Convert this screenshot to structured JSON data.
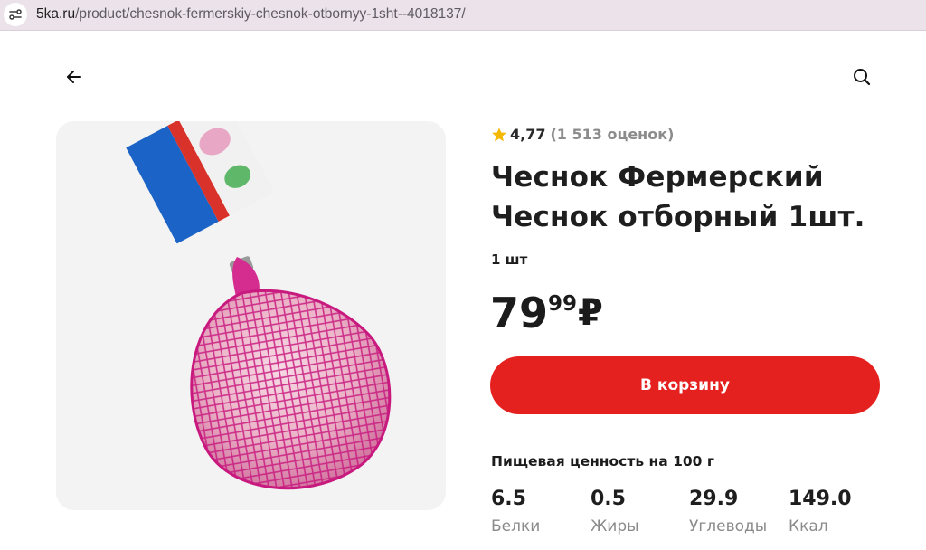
{
  "browser": {
    "url_host": "5ka.ru",
    "url_path": "/product/chesnok-fermerskiy-chesnok-otbornyy-1sht--4018137/"
  },
  "header": {
    "back_icon": "arrow-left-icon",
    "search_icon": "search-icon"
  },
  "product": {
    "image_alt_icon": "garlic-in-net-bag",
    "rating": {
      "score": "4,77",
      "count": "(1 513 оценок)",
      "star_color": "#f5b800"
    },
    "title_line1": "Чеснок Фермерский",
    "title_line2": "Чеснок отборный 1шт.",
    "weight": "1 шт",
    "price": {
      "rubles": "79",
      "kopecks": "99",
      "currency": "₽"
    },
    "cart_button": "В корзину",
    "accent_color": "#e5211f"
  },
  "nutrition": {
    "title": "Пищевая ценность на 100 г",
    "items": [
      {
        "value": "6.5",
        "label": "Белки"
      },
      {
        "value": "0.5",
        "label": "Жиры"
      },
      {
        "value": "29.9",
        "label": "Углеводы"
      },
      {
        "value": "149.0",
        "label": "Ккал"
      }
    ]
  }
}
